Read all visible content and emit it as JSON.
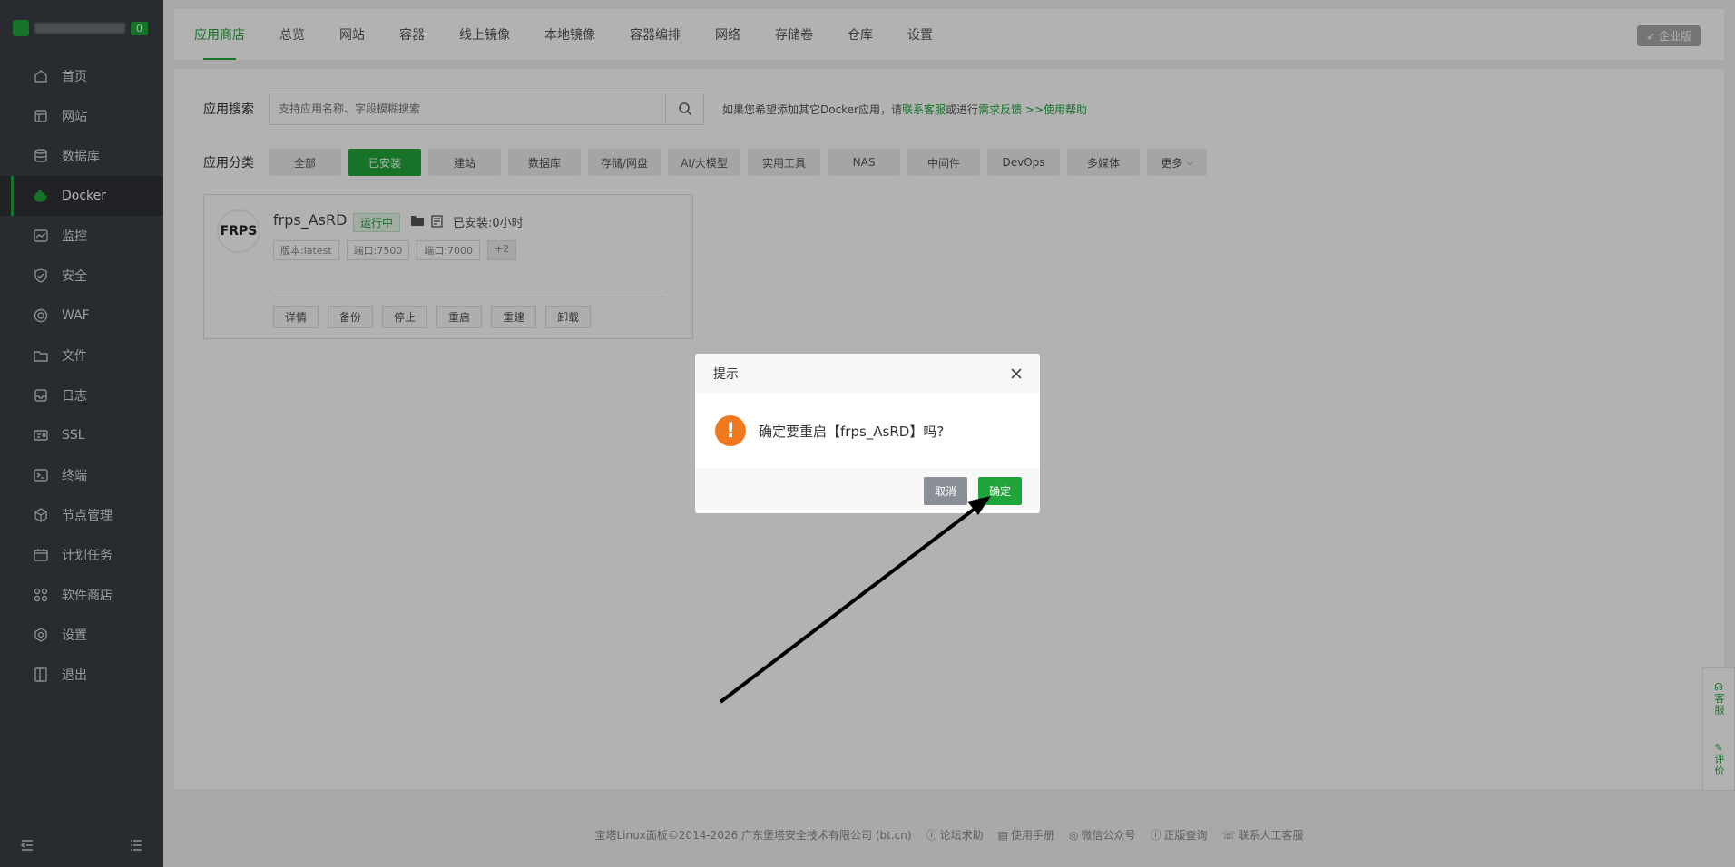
{
  "sidebar": {
    "badge": "0",
    "items": [
      {
        "label": "首页",
        "icon": "home-icon"
      },
      {
        "label": "网站",
        "icon": "website-icon"
      },
      {
        "label": "数据库",
        "icon": "database-icon"
      },
      {
        "label": "Docker",
        "icon": "docker-icon"
      },
      {
        "label": "监控",
        "icon": "monitor-icon"
      },
      {
        "label": "安全",
        "icon": "shield-icon"
      },
      {
        "label": "WAF",
        "icon": "waf-icon"
      },
      {
        "label": "文件",
        "icon": "folder-icon"
      },
      {
        "label": "日志",
        "icon": "log-icon"
      },
      {
        "label": "SSL",
        "icon": "ssl-icon"
      },
      {
        "label": "终端",
        "icon": "terminal-icon"
      },
      {
        "label": "节点管理",
        "icon": "node-icon"
      },
      {
        "label": "计划任务",
        "icon": "calendar-icon"
      },
      {
        "label": "软件商店",
        "icon": "apps-icon"
      },
      {
        "label": "设置",
        "icon": "gear-icon"
      },
      {
        "label": "退出",
        "icon": "logout-icon"
      }
    ]
  },
  "tabs": [
    "应用商店",
    "总览",
    "网站",
    "容器",
    "线上镜像",
    "本地镜像",
    "容器编排",
    "网络",
    "存储卷",
    "仓库",
    "设置"
  ],
  "enterprise_label": "企业版",
  "search": {
    "label": "应用搜索",
    "placeholder": "支持应用名称、字段模糊搜索",
    "hint_prefix": "如果您希望添加其它Docker应用，请",
    "hint_link1": "联系客服",
    "hint_mid": "或进行",
    "hint_link2": "需求反馈",
    "hint_link3": ">>使用帮助"
  },
  "categories": {
    "label": "应用分类",
    "items": [
      "全部",
      "已安装",
      "建站",
      "数据库",
      "存储/网盘",
      "AI/大模型",
      "实用工具",
      "NAS",
      "中间件",
      "DevOps",
      "多媒体",
      "更多"
    ]
  },
  "app": {
    "logo_text": "FRPS",
    "name": "frps_AsRD",
    "status": "运行中",
    "installed": "已安装:0小时",
    "tags": [
      "版本:latest",
      "端口:7500",
      "端口:7000",
      "+2"
    ],
    "actions": [
      "详情",
      "备份",
      "停止",
      "重启",
      "重建",
      "卸载"
    ]
  },
  "footer": {
    "copyright": "宝塔Linux面板©2014-2026 广东堡塔安全技术有限公司 (bt.cn)",
    "links": [
      "论坛求助",
      "使用手册",
      "微信公众号",
      "正版查询",
      "联系人工客服"
    ]
  },
  "side_float": {
    "service": "客服",
    "review": "评价"
  },
  "dialog": {
    "title": "提示",
    "message": "确定要重启【frps_AsRD】吗?",
    "cancel": "取消",
    "confirm": "确定"
  },
  "colors": {
    "accent": "#20a53a",
    "warning": "#f0791f",
    "sidebar": "#3a3e45"
  }
}
